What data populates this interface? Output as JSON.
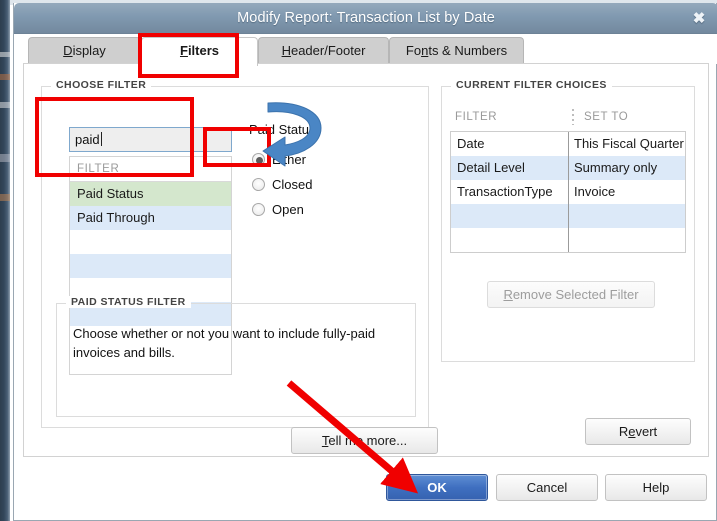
{
  "window": {
    "title": "Modify Report: Transaction List by Date",
    "close_icon": "close-icon",
    "close_glyph": "✖"
  },
  "tabs": [
    {
      "label": "Display",
      "accel": "D",
      "before": "",
      "after": "isplay",
      "active": false
    },
    {
      "label": "Filters",
      "accel": "F",
      "before": "",
      "after": "ilters",
      "active": true
    },
    {
      "label": "Header/Footer",
      "accel": "H",
      "before": "",
      "after": "eader/Footer",
      "active": false
    },
    {
      "label": "Fonts & Numbers",
      "accel": "n",
      "before": "Fo",
      "after": "ts & Numbers",
      "active": false
    }
  ],
  "choose_filter": {
    "legend": "CHOOSE FILTER",
    "search": {
      "value": "paid",
      "placeholder": ""
    },
    "list_header": "FILTER",
    "items": [
      {
        "label": "Paid Status",
        "state": "green"
      },
      {
        "label": "Paid Through",
        "state": "blue"
      },
      {
        "label": "",
        "state": "white"
      },
      {
        "label": "",
        "state": "blue"
      },
      {
        "label": "",
        "state": "white"
      },
      {
        "label": "",
        "state": "blue"
      },
      {
        "label": "",
        "state": "white"
      }
    ],
    "radio_group": {
      "title": "Paid Status",
      "options": [
        {
          "label": "Either",
          "selected": true
        },
        {
          "label": "Closed",
          "selected": false
        },
        {
          "label": "Open",
          "selected": false
        }
      ]
    }
  },
  "description": {
    "legend": "PAID STATUS FILTER",
    "text": "Choose whether or not you want to include fully-paid invoices and bills.",
    "tell_more": {
      "accel": "T",
      "before": "",
      "after": "ell me more..."
    }
  },
  "current_filters": {
    "legend": "CURRENT FILTER CHOICES",
    "columns": {
      "filter": "FILTER",
      "set_to": "SET TO"
    },
    "rows": [
      {
        "filter": "Date",
        "set_to": "This Fiscal Quarter",
        "band": "white"
      },
      {
        "filter": "Detail Level",
        "set_to": "Summary only",
        "band": "blue"
      },
      {
        "filter": "TransactionType",
        "set_to": "Invoice",
        "band": "white"
      },
      {
        "filter": "",
        "set_to": "",
        "band": "blue"
      },
      {
        "filter": "",
        "set_to": "",
        "band": "white"
      }
    ],
    "remove_button": {
      "accel": "R",
      "before": "",
      "after": "emove Selected Filter",
      "disabled": true
    }
  },
  "footer": {
    "revert": {
      "before": "R",
      "accel": "e",
      "after": "vert"
    },
    "ok": "OK",
    "cancel": "Cancel",
    "help": "Help"
  },
  "colors": {
    "titlebar": "#7d95ac",
    "primary_button": "#3f6fc0",
    "annotation_red": "#f00000",
    "annotation_blue": "#4a86c5",
    "row_highlight_green": "#d4e7cd",
    "row_band_blue": "#dce9f8"
  }
}
